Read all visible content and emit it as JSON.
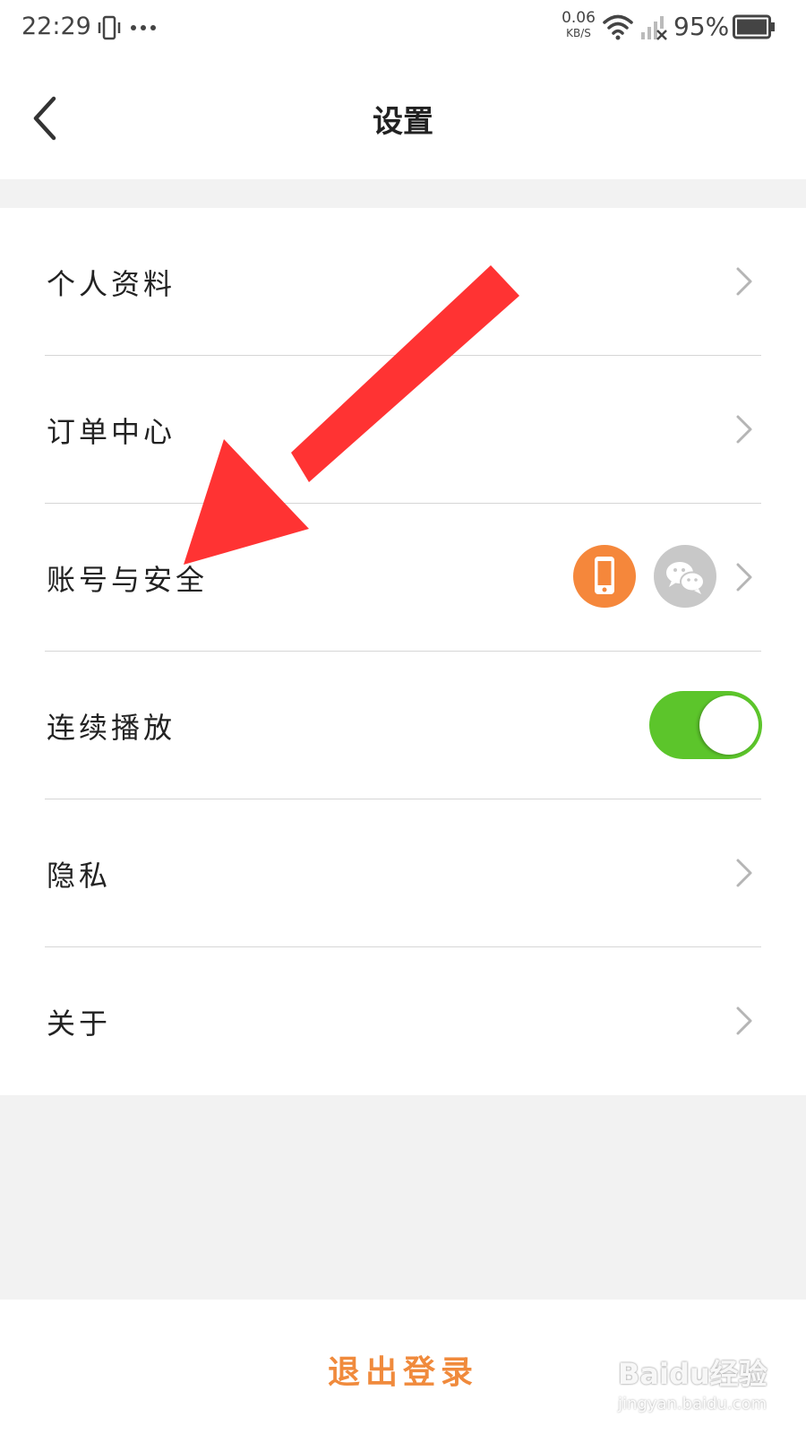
{
  "status_bar": {
    "time": "22:29",
    "net_speed_value": "0.06",
    "net_speed_unit": "KB/S",
    "battery": "95%",
    "icons": [
      "vibrate-icon",
      "more-icon",
      "wifi-icon",
      "signal-icon",
      "battery-icon"
    ]
  },
  "header": {
    "title": "设置",
    "back_icon": "chevron-left-icon"
  },
  "settings": {
    "items": [
      {
        "label": "个人资料",
        "control": "chevron"
      },
      {
        "label": "订单中心",
        "control": "chevron"
      },
      {
        "label": "账号与安全",
        "control": "chevron",
        "badges": [
          "phone-icon",
          "wechat-icon"
        ]
      },
      {
        "label": "连续播放",
        "control": "toggle",
        "toggle_on": true
      },
      {
        "label": "隐私",
        "control": "chevron"
      },
      {
        "label": "关于",
        "control": "chevron"
      }
    ]
  },
  "footer": {
    "logout_label": "退出登录"
  },
  "annotation": {
    "arrow_color": "#ff3333"
  },
  "watermark": {
    "brand": "Baidu经验",
    "site": "jingyan.baidu.com"
  },
  "colors": {
    "accent_orange": "#f08a3c",
    "phone_badge": "#f5873b",
    "toggle_on": "#5cc52b",
    "badge_gray": "#c8c8c8"
  }
}
